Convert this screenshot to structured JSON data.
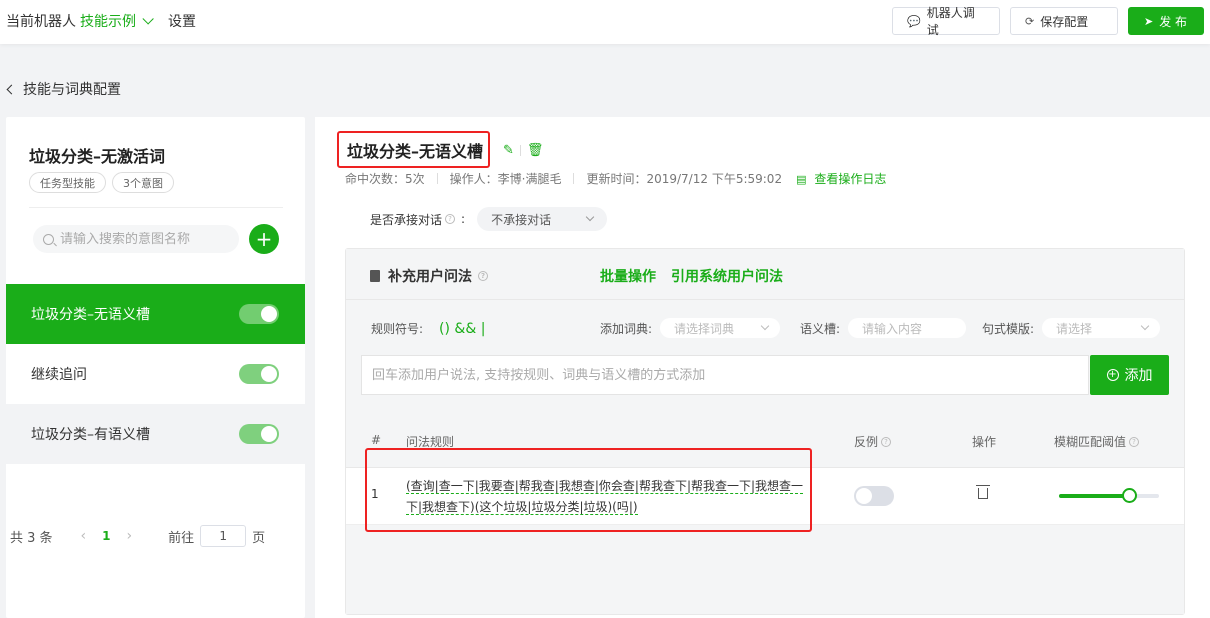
{
  "header": {
    "current_robot_label": "当前机器人",
    "skill_example": "技能示例",
    "settings": "设置",
    "debug_button": "机器人调试",
    "save_button": "保存配置",
    "publish_button": "发 布"
  },
  "back_link": "技能与词典配置",
  "skill": {
    "title": "垃圾分类–无激活词",
    "tags": [
      "任务型技能",
      "3个意图"
    ],
    "search_placeholder": "请输入搜索的意图名称",
    "intents": [
      {
        "name": "垃圾分类–无语义槽",
        "enabled": true,
        "active": true
      },
      {
        "name": "继续追问",
        "enabled": true,
        "active": false
      },
      {
        "name": "垃圾分类–有语义槽",
        "enabled": true,
        "active": false
      }
    ]
  },
  "pagination": {
    "total": "共 3 条",
    "current": "1",
    "goto_label": "前往",
    "page_input": "1",
    "page_suffix": "页"
  },
  "intent": {
    "title": "垃圾分类–无语义槽",
    "hits": "命中次数：5次",
    "operator": "操作人：李博·满腿毛",
    "updated": "更新时间：2019/7/12 下午5:59:02",
    "log_link": "查看操作日志",
    "context_label": "是否承接对话",
    "context_value": "不承接对话"
  },
  "card": {
    "title": "补充用户问法",
    "batch": "批量操作",
    "cite": "引用系统用户问法",
    "rule_symbols_label": "规则符号:",
    "rule_symbols": "() && |",
    "add_dict_label": "添加词典:",
    "add_dict_placeholder": "请选择词典",
    "slot_label": "语义槽:",
    "slot_placeholder": "请输入内容",
    "template_label": "句式模版:",
    "template_placeholder": "请选择",
    "input_placeholder": "回车添加用户说法, 支持按规则、词典与语义槽的方式添加",
    "add_button": "添加"
  },
  "table": {
    "headers": {
      "index": "#",
      "rule": "问法规则",
      "negative": "反例",
      "action": "操作",
      "threshold": "模糊匹配阈值"
    },
    "rows": [
      {
        "index": "1",
        "rule": "(查询|查一下|我要查|帮我查|我想查|你会查|帮我查下|帮我查一下|我想查一下|我想查下)(这个垃圾|垃圾分类|垃圾)(吗|)",
        "negative": false,
        "threshold": 0.7
      }
    ]
  },
  "colors": {
    "accent": "#1aad19",
    "highlight": "#e22222"
  }
}
